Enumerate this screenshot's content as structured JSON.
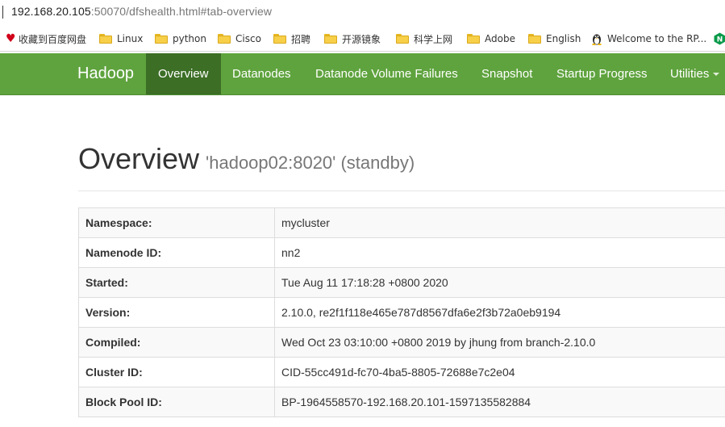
{
  "address_bar": {
    "host": "192.168.20.105",
    "rest": ":50070/dfshealth.html#tab-overview"
  },
  "bookmarks": [
    {
      "label": "收藏到百度网盘",
      "icon": "heart-icon"
    },
    {
      "label": "Linux",
      "icon": "folder-icon"
    },
    {
      "label": "python",
      "icon": "folder-icon"
    },
    {
      "label": "Cisco",
      "icon": "folder-icon"
    },
    {
      "label": "招聘",
      "icon": "folder-icon"
    },
    {
      "label": "开源镜象",
      "icon": "folder-icon"
    },
    {
      "label": "科学上网",
      "icon": "folder-icon"
    },
    {
      "label": "Adobe",
      "icon": "folder-icon"
    },
    {
      "label": "English",
      "icon": "folder-icon"
    },
    {
      "label": "Welcome to the RP...",
      "icon": "linux-icon"
    },
    {
      "label": "",
      "icon": "nginx-icon"
    }
  ],
  "navbar": {
    "brand": "Hadoop",
    "items": [
      {
        "label": "Overview",
        "active": true
      },
      {
        "label": "Datanodes"
      },
      {
        "label": "Datanode Volume Failures"
      },
      {
        "label": "Snapshot"
      },
      {
        "label": "Startup Progress"
      },
      {
        "label": "Utilities"
      }
    ]
  },
  "header": {
    "title": "Overview",
    "subtitle": "'hadoop02:8020' (standby)"
  },
  "info_table": [
    {
      "label": "Namespace:",
      "value": "mycluster"
    },
    {
      "label": "Namenode ID:",
      "value": "nn2"
    },
    {
      "label": "Started:",
      "value": "Tue Aug 11 17:18:28 +0800 2020"
    },
    {
      "label": "Version:",
      "value": "2.10.0, re2f1f118e465e787d8567dfa6e2f3b72a0eb9194"
    },
    {
      "label": "Compiled:",
      "value": "Wed Oct 23 03:10:00 +0800 2019 by jhung from branch-2.10.0"
    },
    {
      "label": "Cluster ID:",
      "value": "CID-55cc491d-fc70-4ba5-8805-72688e7c2e04"
    },
    {
      "label": "Block Pool ID:",
      "value": "BP-1964558570-192.168.20.101-1597135582884"
    }
  ],
  "colors": {
    "navbar": "#5fa33e",
    "navbar_active": "#3c6e26"
  }
}
